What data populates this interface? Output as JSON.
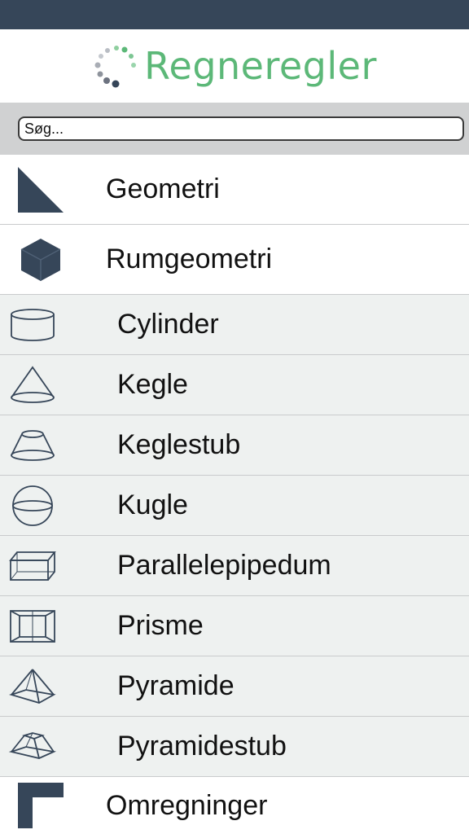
{
  "app": {
    "title": "Regneregler"
  },
  "search": {
    "placeholder": "Søg..."
  },
  "colors": {
    "statusbar": "#364659",
    "accent": "#5cb878",
    "icon": "#364659"
  },
  "menu": [
    {
      "label": "Geometri",
      "icon": "triangle-icon",
      "level": "main"
    },
    {
      "label": "Rumgeometri",
      "icon": "cube-icon",
      "level": "main"
    },
    {
      "label": "Cylinder",
      "icon": "cylinder-icon",
      "level": "sub"
    },
    {
      "label": "Kegle",
      "icon": "cone-icon",
      "level": "sub"
    },
    {
      "label": "Keglestub",
      "icon": "frustum-icon",
      "level": "sub"
    },
    {
      "label": "Kugle",
      "icon": "sphere-icon",
      "level": "sub"
    },
    {
      "label": "Parallelepipedum",
      "icon": "box-icon",
      "level": "sub"
    },
    {
      "label": "Prisme",
      "icon": "prism-icon",
      "level": "sub"
    },
    {
      "label": "Pyramide",
      "icon": "pyramid-icon",
      "level": "sub"
    },
    {
      "label": "Pyramidestub",
      "icon": "pyramid-frustum-icon",
      "level": "sub"
    },
    {
      "label": "Omregninger",
      "icon": "corner-icon",
      "level": "main"
    }
  ]
}
